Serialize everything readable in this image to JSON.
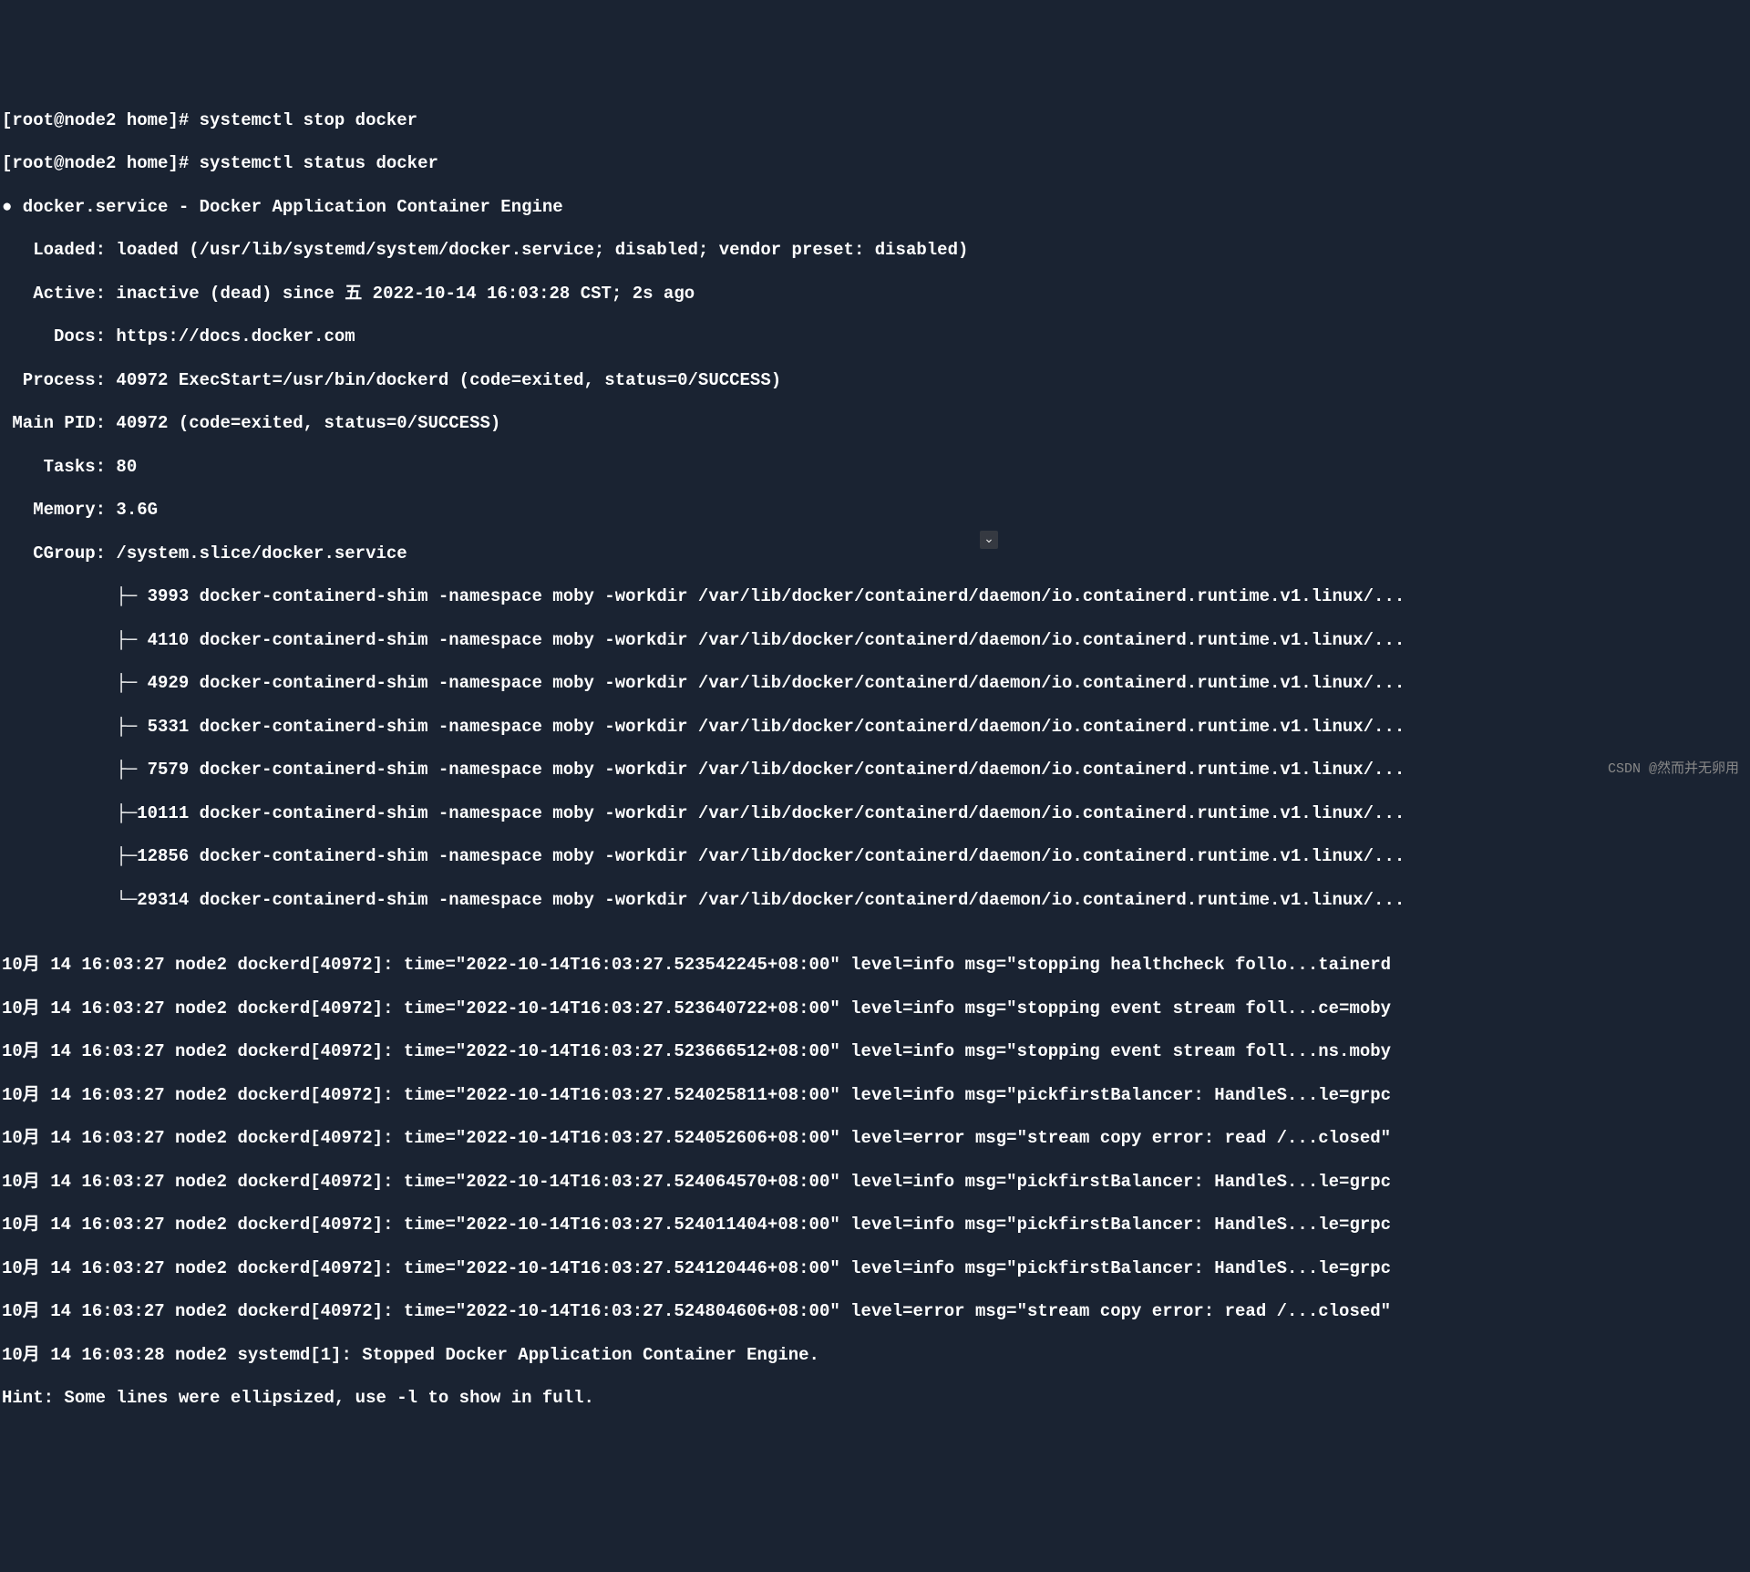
{
  "prompt1": "[root@node2 home]# ",
  "cmd1": "systemctl stop docker",
  "prompt2": "[root@node2 home]# ",
  "cmd2": "systemctl status docker",
  "service_header": "● docker.service - Docker Application Container Engine",
  "loaded": "   Loaded: loaded (/usr/lib/systemd/system/docker.service; disabled; vendor preset: disabled)",
  "active": "   Active: inactive (dead) since 五 2022-10-14 16:03:28 CST; 2s ago",
  "docs": "     Docs: https://docs.docker.com",
  "process": "  Process: 40972 ExecStart=/usr/bin/dockerd (code=exited, status=0/SUCCESS)",
  "mainpid": " Main PID: 40972 (code=exited, status=0/SUCCESS)",
  "tasks": "    Tasks: 80",
  "memory": "   Memory: 3.6G",
  "cgroup": "   CGroup: /system.slice/docker.service",
  "cg1": "           ├─ 3993 docker-containerd-shim -namespace moby -workdir /var/lib/docker/containerd/daemon/io.containerd.runtime.v1.linux/...",
  "cg2": "           ├─ 4110 docker-containerd-shim -namespace moby -workdir /var/lib/docker/containerd/daemon/io.containerd.runtime.v1.linux/...",
  "cg3": "           ├─ 4929 docker-containerd-shim -namespace moby -workdir /var/lib/docker/containerd/daemon/io.containerd.runtime.v1.linux/...",
  "cg4": "           ├─ 5331 docker-containerd-shim -namespace moby -workdir /var/lib/docker/containerd/daemon/io.containerd.runtime.v1.linux/...",
  "cg5": "           ├─ 7579 docker-containerd-shim -namespace moby -workdir /var/lib/docker/containerd/daemon/io.containerd.runtime.v1.linux/...",
  "cg6": "           ├─10111 docker-containerd-shim -namespace moby -workdir /var/lib/docker/containerd/daemon/io.containerd.runtime.v1.linux/...",
  "cg7": "           ├─12856 docker-containerd-shim -namespace moby -workdir /var/lib/docker/containerd/daemon/io.containerd.runtime.v1.linux/...",
  "cg8": "           └─29314 docker-containerd-shim -namespace moby -workdir /var/lib/docker/containerd/daemon/io.containerd.runtime.v1.linux/...",
  "blank": "",
  "log1": "10月 14 16:03:27 node2 dockerd[40972]: time=\"2022-10-14T16:03:27.523542245+08:00\" level=info msg=\"stopping healthcheck follo...tainerd",
  "log2": "10月 14 16:03:27 node2 dockerd[40972]: time=\"2022-10-14T16:03:27.523640722+08:00\" level=info msg=\"stopping event stream foll...ce=moby",
  "log3": "10月 14 16:03:27 node2 dockerd[40972]: time=\"2022-10-14T16:03:27.523666512+08:00\" level=info msg=\"stopping event stream foll...ns.moby",
  "log4": "10月 14 16:03:27 node2 dockerd[40972]: time=\"2022-10-14T16:03:27.524025811+08:00\" level=info msg=\"pickfirstBalancer: HandleS...le=grpc",
  "log5": "10月 14 16:03:27 node2 dockerd[40972]: time=\"2022-10-14T16:03:27.524052606+08:00\" level=error msg=\"stream copy error: read /...closed\"",
  "log6": "10月 14 16:03:27 node2 dockerd[40972]: time=\"2022-10-14T16:03:27.524064570+08:00\" level=info msg=\"pickfirstBalancer: HandleS...le=grpc",
  "log7": "10月 14 16:03:27 node2 dockerd[40972]: time=\"2022-10-14T16:03:27.524011404+08:00\" level=info msg=\"pickfirstBalancer: HandleS...le=grpc",
  "log8": "10月 14 16:03:27 node2 dockerd[40972]: time=\"2022-10-14T16:03:27.524120446+08:00\" level=info msg=\"pickfirstBalancer: HandleS...le=grpc",
  "log9": "10月 14 16:03:27 node2 dockerd[40972]: time=\"2022-10-14T16:03:27.524804606+08:00\" level=error msg=\"stream copy error: read /...closed\"",
  "log10": "10月 14 16:03:28 node2 systemd[1]: Stopped Docker Application Container Engine.",
  "hint": "Hint: Some lines were ellipsized, use -l to show in full.",
  "watermark": "CSDN @然而并无卵用",
  "scroll_icon": "⌄"
}
